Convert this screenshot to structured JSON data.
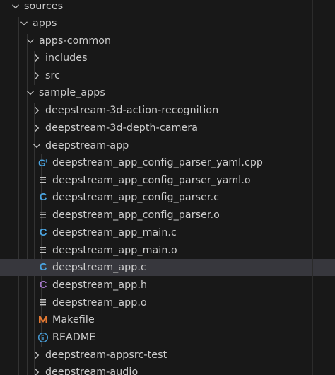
{
  "colors": {
    "background": "#181818",
    "text": "#cccccc",
    "selected_row": "#37373d",
    "c_icon": "#4aa3df",
    "h_icon": "#a074c4",
    "makefile_icon": "#e37933",
    "info_icon": "#4aa3df",
    "lines_icon": "#c5c5c5"
  },
  "tree": {
    "sources": {
      "label": "sources",
      "icon": "chevron-down-icon"
    },
    "apps": {
      "label": "apps",
      "icon": "chevron-down-icon"
    },
    "apps_common": {
      "label": "apps-common",
      "icon": "chevron-down-icon"
    },
    "includes": {
      "label": "includes",
      "icon": "chevron-right-icon"
    },
    "src": {
      "label": "src",
      "icon": "chevron-right-icon"
    },
    "sample_apps": {
      "label": "sample_apps",
      "icon": "chevron-down-icon"
    },
    "ds_3d_action": {
      "label": "deepstream-3d-action-recognition",
      "icon": "chevron-right-icon"
    },
    "ds_3d_depth": {
      "label": "deepstream-3d-depth-camera",
      "icon": "chevron-right-icon"
    },
    "ds_app": {
      "label": "deepstream-app",
      "icon": "chevron-down-icon"
    },
    "files": [
      {
        "label": "deepstream_app_config_parser_yaml.cpp",
        "icon": "cpp-file-icon",
        "glyph": "G",
        "selected": false
      },
      {
        "label": "deepstream_app_config_parser_yaml.o",
        "icon": "lines-file-icon",
        "selected": false
      },
      {
        "label": "deepstream_app_config_parser.c",
        "icon": "c-file-icon",
        "glyph": "C",
        "selected": false
      },
      {
        "label": "deepstream_app_config_parser.o",
        "icon": "lines-file-icon",
        "selected": false
      },
      {
        "label": "deepstream_app_main.c",
        "icon": "c-file-icon",
        "glyph": "C",
        "selected": false
      },
      {
        "label": "deepstream_app_main.o",
        "icon": "lines-file-icon",
        "selected": false
      },
      {
        "label": "deepstream_app.c",
        "icon": "c-file-icon",
        "glyph": "C",
        "selected": true
      },
      {
        "label": "deepstream_app.h",
        "icon": "h-file-icon",
        "glyph": "C",
        "selected": false
      },
      {
        "label": "deepstream_app.o",
        "icon": "lines-file-icon",
        "selected": false
      },
      {
        "label": "Makefile",
        "icon": "makefile-icon",
        "glyph": "M",
        "selected": false
      },
      {
        "label": "README",
        "icon": "info-icon",
        "glyph": "i",
        "selected": false
      }
    ],
    "ds_appsrc_test": {
      "label": "deepstream-appsrc-test",
      "icon": "chevron-right-icon"
    },
    "ds_audio": {
      "label": "deepstream-audio",
      "icon": "chevron-right-icon"
    }
  }
}
